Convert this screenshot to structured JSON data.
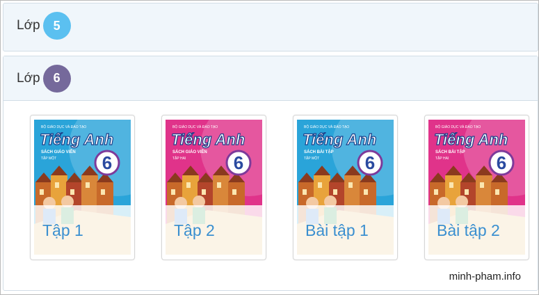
{
  "grades": [
    {
      "label": "Lớp",
      "number": "5",
      "badge_color": "#5bc0f0"
    },
    {
      "label": "Lớp",
      "number": "6",
      "badge_color": "#75699b"
    }
  ],
  "books": [
    {
      "caption": "Tập 1",
      "cover_title": "Tiếng Anh",
      "cover_number": "6",
      "cover_publisher": "BỘ GIÁO DỤC VÀ ĐÀO TẠO",
      "cover_subtitle": "SÁCH GIÁO VIÊN",
      "cover_volume": "TẬP MỘT",
      "theme_color": "#2aa4d9"
    },
    {
      "caption": "Tập 2",
      "cover_title": "Tiếng Anh",
      "cover_number": "6",
      "cover_publisher": "BỘ GIÁO DỤC VÀ ĐÀO TẠO",
      "cover_subtitle": "SÁCH GIÁO VIÊN",
      "cover_volume": "TẬP HAI",
      "theme_color": "#e0338a"
    },
    {
      "caption": "Bài tập 1",
      "cover_title": "Tiếng Anh",
      "cover_number": "6",
      "cover_publisher": "BỘ GIÁO DỤC VÀ ĐÀO TẠO",
      "cover_subtitle": "SÁCH BÀI TẬP",
      "cover_volume": "TẬP MỘT",
      "theme_color": "#2aa4d9"
    },
    {
      "caption": "Bài tập 2",
      "cover_title": "Tiếng Anh",
      "cover_number": "6",
      "cover_publisher": "BỘ GIÁO DỤC VÀ ĐÀO TẠO",
      "cover_subtitle": "SÁCH BÀI TẬP",
      "cover_volume": "TẬP HAI",
      "theme_color": "#e0338a"
    }
  ],
  "watermark": "minh-pham.info"
}
